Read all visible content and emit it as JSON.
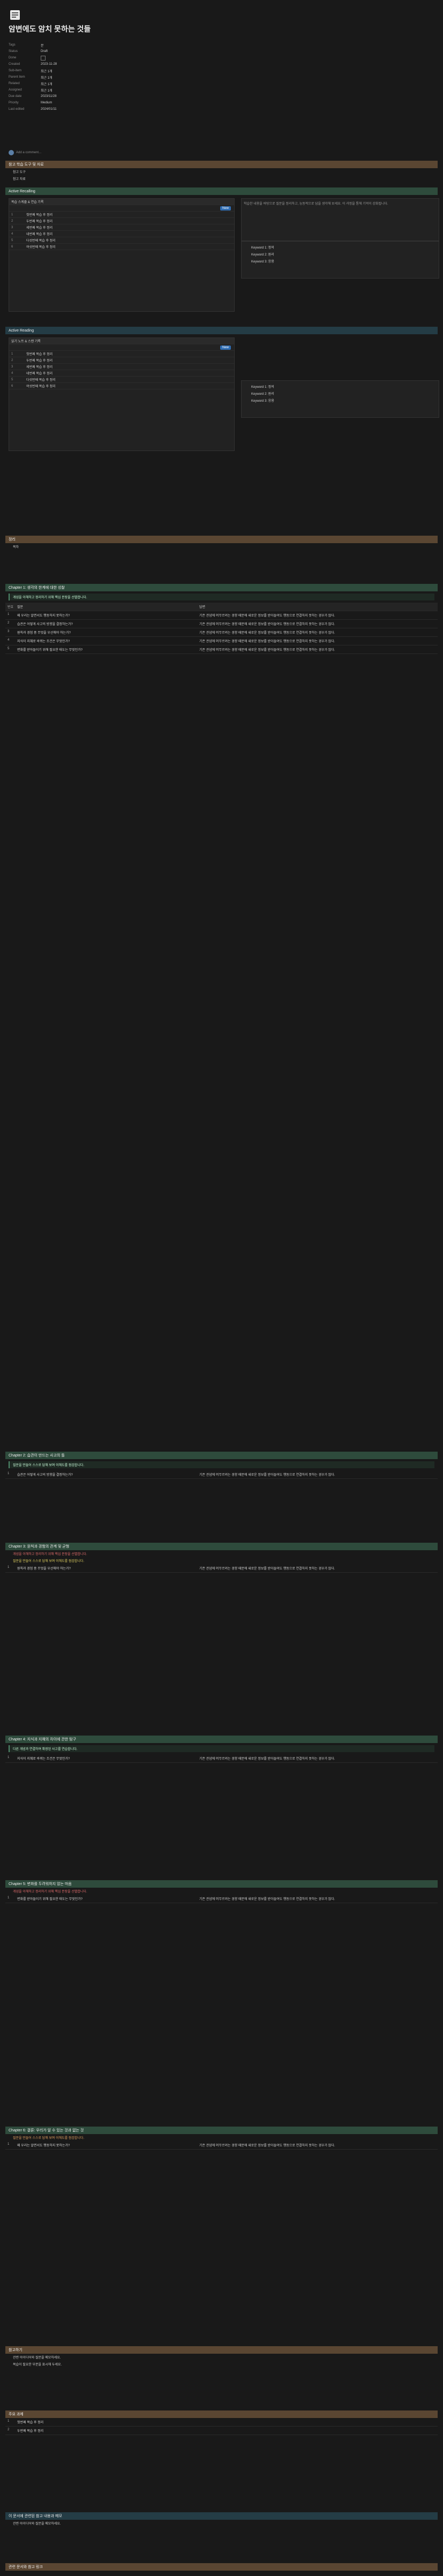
{
  "page": {
    "title": "암변에도 암치 못하는 것들",
    "icon_name": "notebook-icon",
    "properties": [
      {
        "key": "Tags",
        "value": "문"
      },
      {
        "key": "Status",
        "value": "Draft"
      },
      {
        "key": "Done",
        "value": ""
      },
      {
        "key": "Created",
        "value": "2023-11-28"
      },
      {
        "key": "Sub-item",
        "value": "최근 1개"
      },
      {
        "key": "Parent item",
        "value": "최근 1개"
      },
      {
        "key": "Related",
        "value": "최근 1개"
      },
      {
        "key": "Assigned",
        "value": "최근 1개"
      },
      {
        "key": "Due date",
        "value": "2023/11/28"
      },
      {
        "key": "Priority",
        "value": "Medium"
      },
      {
        "key": "Last edited",
        "value": "2024/01/11"
      }
    ],
    "comment_placeholder": "Add a comment..."
  },
  "sections": {
    "s1": "참고 학습 도구 및 자료",
    "s1_items": [
      "참고 도구",
      "참고 자료"
    ],
    "green1": "Active Recalling",
    "green1_sub": "복습 스케줄 & 연습 기록",
    "green2": "Active Reading",
    "green2_sub": "읽기 노트 & 스캔 기록",
    "view_label": "New",
    "table_rows": [
      "첫번째 복습 후 정리",
      "두번째 복습 후 정리",
      "세번째 복습 후 정리",
      "네번째 복습 후 정리",
      "다섯번째 복습 후 정리",
      "여섯번째 복습 후 정리"
    ],
    "side_note_1": "학습한 내용을 바탕으로 질문을 정리하고, 능동적으로 답을 생각해 보세요. 이 과정을 통해 기억이 강화됩니다.",
    "side_items": [
      "Keyword 1: 정의",
      "Keyword 2: 원리",
      "Keyword 3: 응용"
    ],
    "summary_bar": "정리",
    "summary_item": "목차",
    "chapters": [
      "Chapter 1: 생각의 한계에 대한 성찰",
      "Chapter 2: 습관이 만드는 사고의 틀",
      "Chapter 3: 원칙과 경험의 관계 및 균형",
      "Chapter 4: 지식과 지혜의 차이에 관한 탐구",
      "Chapter 5: 변화를 두려워하지 않는 마음",
      "Chapter 6: 결론: 우리가 알 수 있는 것과 없는 것"
    ],
    "chapter_bullets": [
      "개념을 이해하고 정리하기 위해 핵심 문장을 선별합니다.",
      "질문을 만들어 스스로 답해 보며 이해도를 점검합니다.",
      "다른 개념과 연결하여 확장된 사고를 연습합니다."
    ],
    "qa_header": [
      "번호",
      "질문",
      "답변"
    ],
    "qa_samples": [
      "왜 우리는 알면서도 행동하지 못하는가?",
      "습관은 어떻게 사고의 방향을 결정하는가?",
      "원칙과 경험 중 무엇을 우선해야 하는가?",
      "지식이 지혜로 바뀌는 조건은 무엇인가?",
      "변화를 받아들이기 위해 필요한 태도는 무엇인가?"
    ],
    "answer_sample": "기존 관념에 머무르려는 경향 때문에 새로운 정보를 받아들여도 행동으로 연결하지 못하는 경우가 많다.",
    "bottom_bar": "참고하기",
    "bottom_tasks_bar": "주요 과제",
    "final_bar": "이 문서에 관련된 참고 내용과 메모",
    "final_item_1": "관련 아이디어와 질문을 메모하세요.",
    "final_item_2": "복습이 필요한 부분을 표시해 두세요.",
    "last_bar": "관련 문서와 참고 링크"
  }
}
